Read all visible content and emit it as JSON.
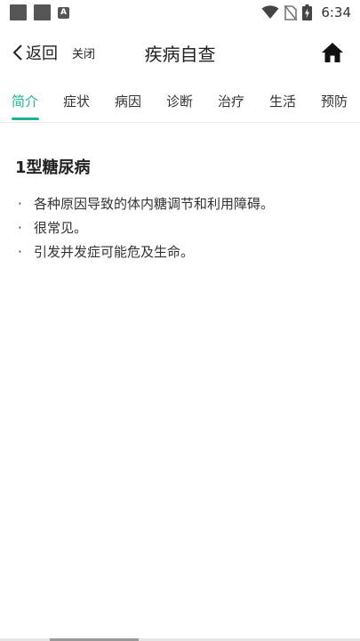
{
  "status_bar": {
    "time": "6:34",
    "left_icons": [
      "notification-square-icon",
      "notification-square-icon",
      "keyboard-a-icon"
    ],
    "right_icons": [
      "wifi-icon",
      "no-sim-icon",
      "battery-charging-icon"
    ]
  },
  "header": {
    "back_label": "返回",
    "close_label": "关闭",
    "title": "疾病自查",
    "home_icon": "home-icon"
  },
  "tabs": [
    {
      "label": "简介",
      "active": true
    },
    {
      "label": "症状",
      "active": false
    },
    {
      "label": "病因",
      "active": false
    },
    {
      "label": "诊断",
      "active": false
    },
    {
      "label": "治疗",
      "active": false
    },
    {
      "label": "生活",
      "active": false
    },
    {
      "label": "预防",
      "active": false
    }
  ],
  "content": {
    "title": "1型糖尿病",
    "bullets": [
      "各种原因导致的体内糖调节和利用障碍。",
      "很常见。",
      "引发并发症可能危及生命。"
    ],
    "bullet_symbol": "·"
  },
  "colors": {
    "accent": "#1db394",
    "text": "#222222"
  }
}
